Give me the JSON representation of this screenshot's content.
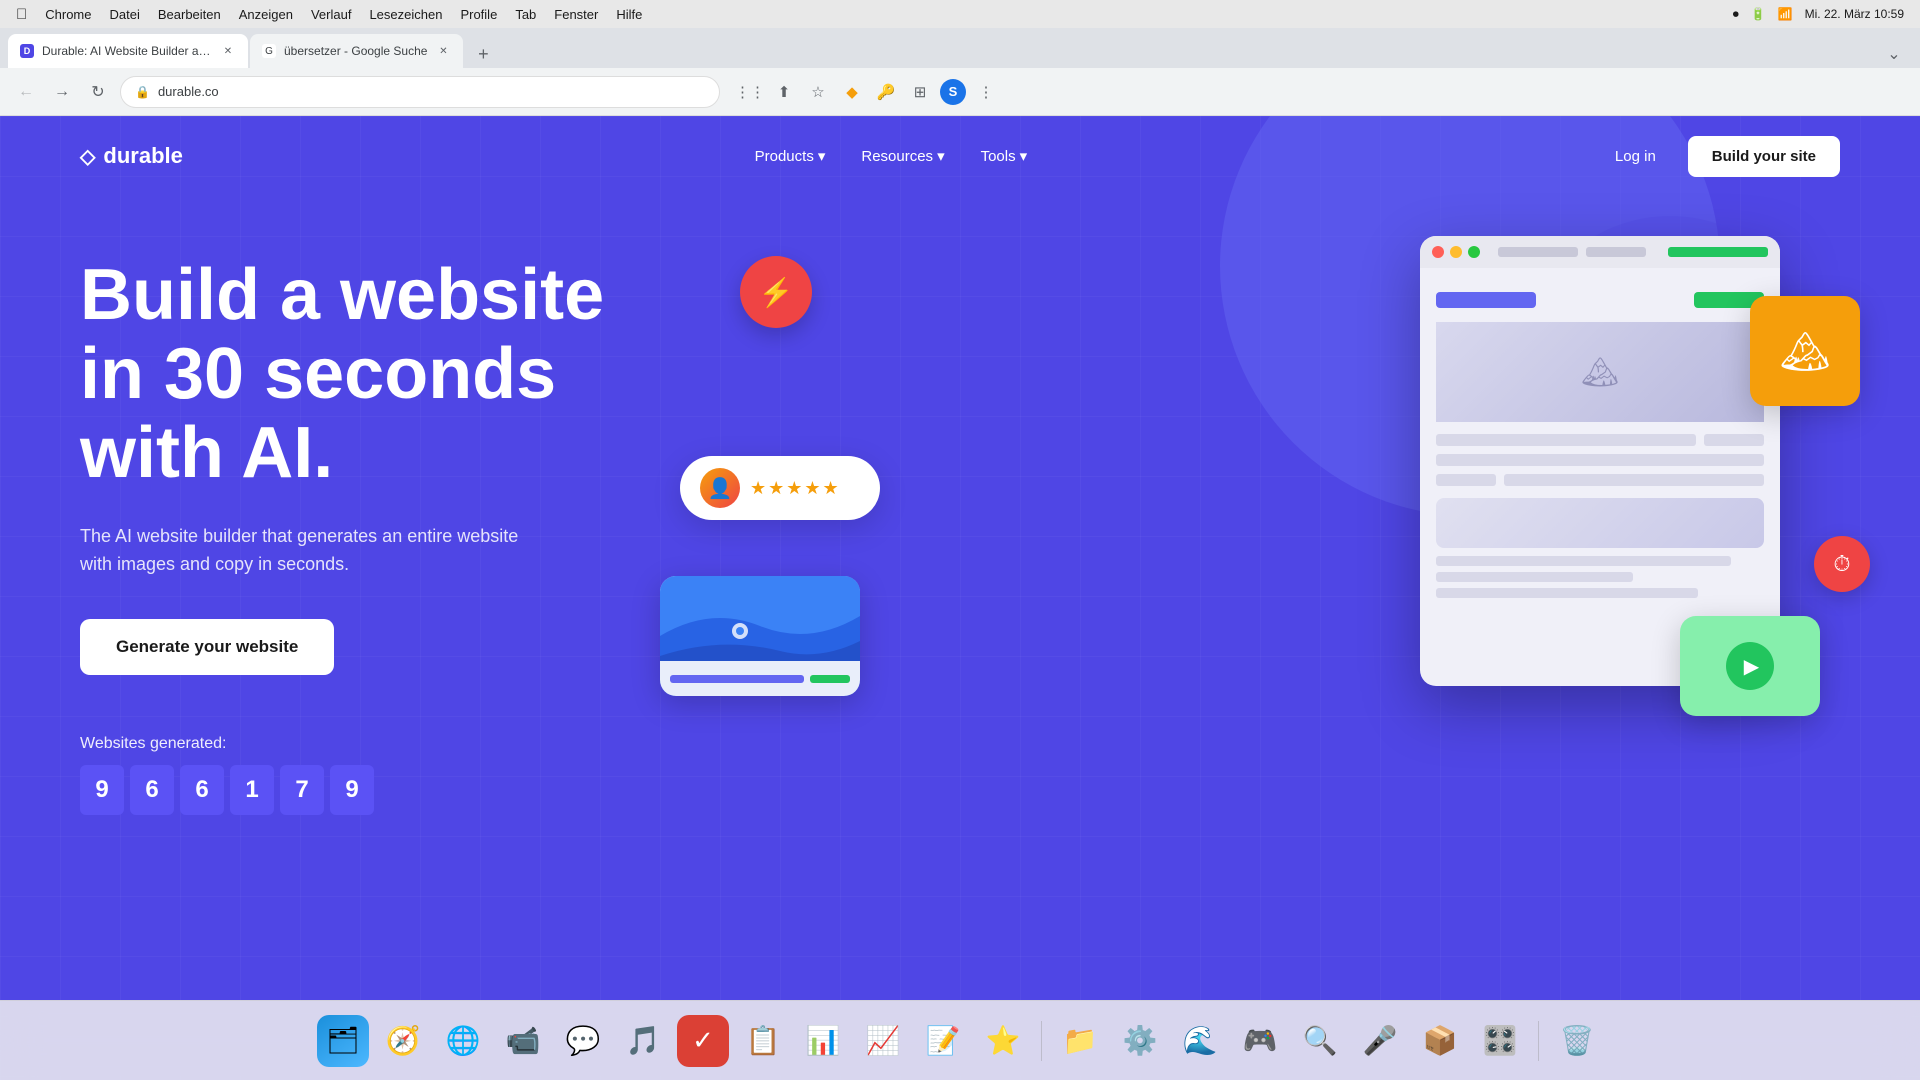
{
  "macos": {
    "apple": "󰀵",
    "menu_items": [
      "Chrome",
      "Datei",
      "Bearbeiten",
      "Anzeigen",
      "Verlauf",
      "Lesezeichen",
      "Profile",
      "Tab",
      "Fenster",
      "Hilfe"
    ],
    "date_time": "Mi. 22. März  10:59"
  },
  "tabs": [
    {
      "id": "tab1",
      "title": "Durable: AI Website Builder an...",
      "url": "durable.co",
      "active": true
    },
    {
      "id": "tab2",
      "title": "übersetzer - Google Suche",
      "url": "google.com",
      "active": false
    }
  ],
  "address_bar": {
    "url": "durable.co"
  },
  "nav": {
    "logo_text": "durable",
    "links": [
      {
        "label": "Products",
        "has_arrow": true
      },
      {
        "label": "Resources",
        "has_arrow": true
      },
      {
        "label": "Tools",
        "has_arrow": true
      }
    ],
    "login_label": "Log in",
    "build_label": "Build your site"
  },
  "hero": {
    "title_line1": "Build a website",
    "title_line2": "in 30 seconds",
    "title_line3": "with AI.",
    "subtitle": "The AI website builder that generates an entire website with images and copy in seconds.",
    "cta_label": "Generate your website",
    "counter_label": "Websites generated:",
    "counter_digits": [
      "9",
      "6",
      "6",
      "1",
      "7",
      "9"
    ]
  },
  "illustration": {
    "browser_dots": [
      "red",
      "yellow",
      "green"
    ]
  },
  "colors": {
    "brand_purple": "#4f46e5",
    "nav_bg": "#5b52f5",
    "white": "#ffffff",
    "counter_bg": "#5b52f5"
  },
  "dock": [
    {
      "name": "finder",
      "emoji": "🔵",
      "label": "Finder"
    },
    {
      "name": "safari",
      "emoji": "🧭",
      "label": "Safari"
    },
    {
      "name": "chrome",
      "emoji": "🌐",
      "label": "Chrome"
    },
    {
      "name": "zoom",
      "emoji": "💬",
      "label": "Zoom"
    },
    {
      "name": "whatsapp",
      "emoji": "📱",
      "label": "WhatsApp"
    },
    {
      "name": "spotify",
      "emoji": "🎵",
      "label": "Spotify"
    },
    {
      "name": "todoist",
      "emoji": "✅",
      "label": "Todoist"
    },
    {
      "name": "trello",
      "emoji": "📋",
      "label": "Trello"
    },
    {
      "name": "excel",
      "emoji": "📊",
      "label": "Excel"
    },
    {
      "name": "powerpoint",
      "emoji": "📈",
      "label": "PowerPoint"
    },
    {
      "name": "word",
      "emoji": "📝",
      "label": "Word"
    },
    {
      "name": "reeder",
      "emoji": "⭐",
      "label": "Reeder"
    },
    {
      "name": "drive",
      "emoji": "📁",
      "label": "Google Drive"
    },
    {
      "name": "preferences",
      "emoji": "⚙️",
      "label": "Preferences"
    },
    {
      "name": "arc",
      "emoji": "🌊",
      "label": "Arc"
    },
    {
      "name": "discord",
      "emoji": "🎮",
      "label": "Discord"
    },
    {
      "name": "quicksilver",
      "emoji": "🔍",
      "label": "QuickSilver"
    },
    {
      "name": "waveform",
      "emoji": "🎤",
      "label": "Waveform"
    },
    {
      "name": "airdrop",
      "emoji": "📦",
      "label": "AirDrop"
    },
    {
      "name": "controls",
      "emoji": "🎛️",
      "label": "Controls"
    },
    {
      "name": "trash",
      "emoji": "🗑️",
      "label": "Trash"
    }
  ]
}
